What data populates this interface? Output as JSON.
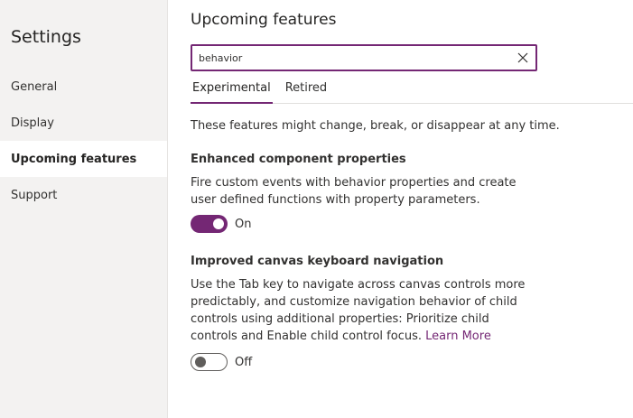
{
  "sidebar": {
    "title": "Settings",
    "items": [
      {
        "label": "General"
      },
      {
        "label": "Display"
      },
      {
        "label": "Upcoming features",
        "active": true
      },
      {
        "label": "Support"
      }
    ]
  },
  "main": {
    "title": "Upcoming features",
    "search": {
      "value": "behavior"
    },
    "tabs": [
      {
        "label": "Experimental",
        "active": true
      },
      {
        "label": "Retired"
      }
    ],
    "notice": "These features might change, break, or disappear at any time.",
    "features": [
      {
        "title": "Enhanced component properties",
        "description": "Fire custom events with behavior properties and create user defined functions with property parameters.",
        "toggle_state": "on",
        "toggle_label": "On"
      },
      {
        "title": "Improved canvas keyboard navigation",
        "description": "Use the Tab key to navigate across canvas controls more predictably, and customize navigation behavior of child controls using additional properties: Prioritize child controls and Enable child control focus.",
        "link": "Learn More",
        "toggle_state": "off",
        "toggle_label": "Off"
      }
    ]
  },
  "colors": {
    "accent": "#742774",
    "sidebar_bg": "#f3f2f1"
  }
}
